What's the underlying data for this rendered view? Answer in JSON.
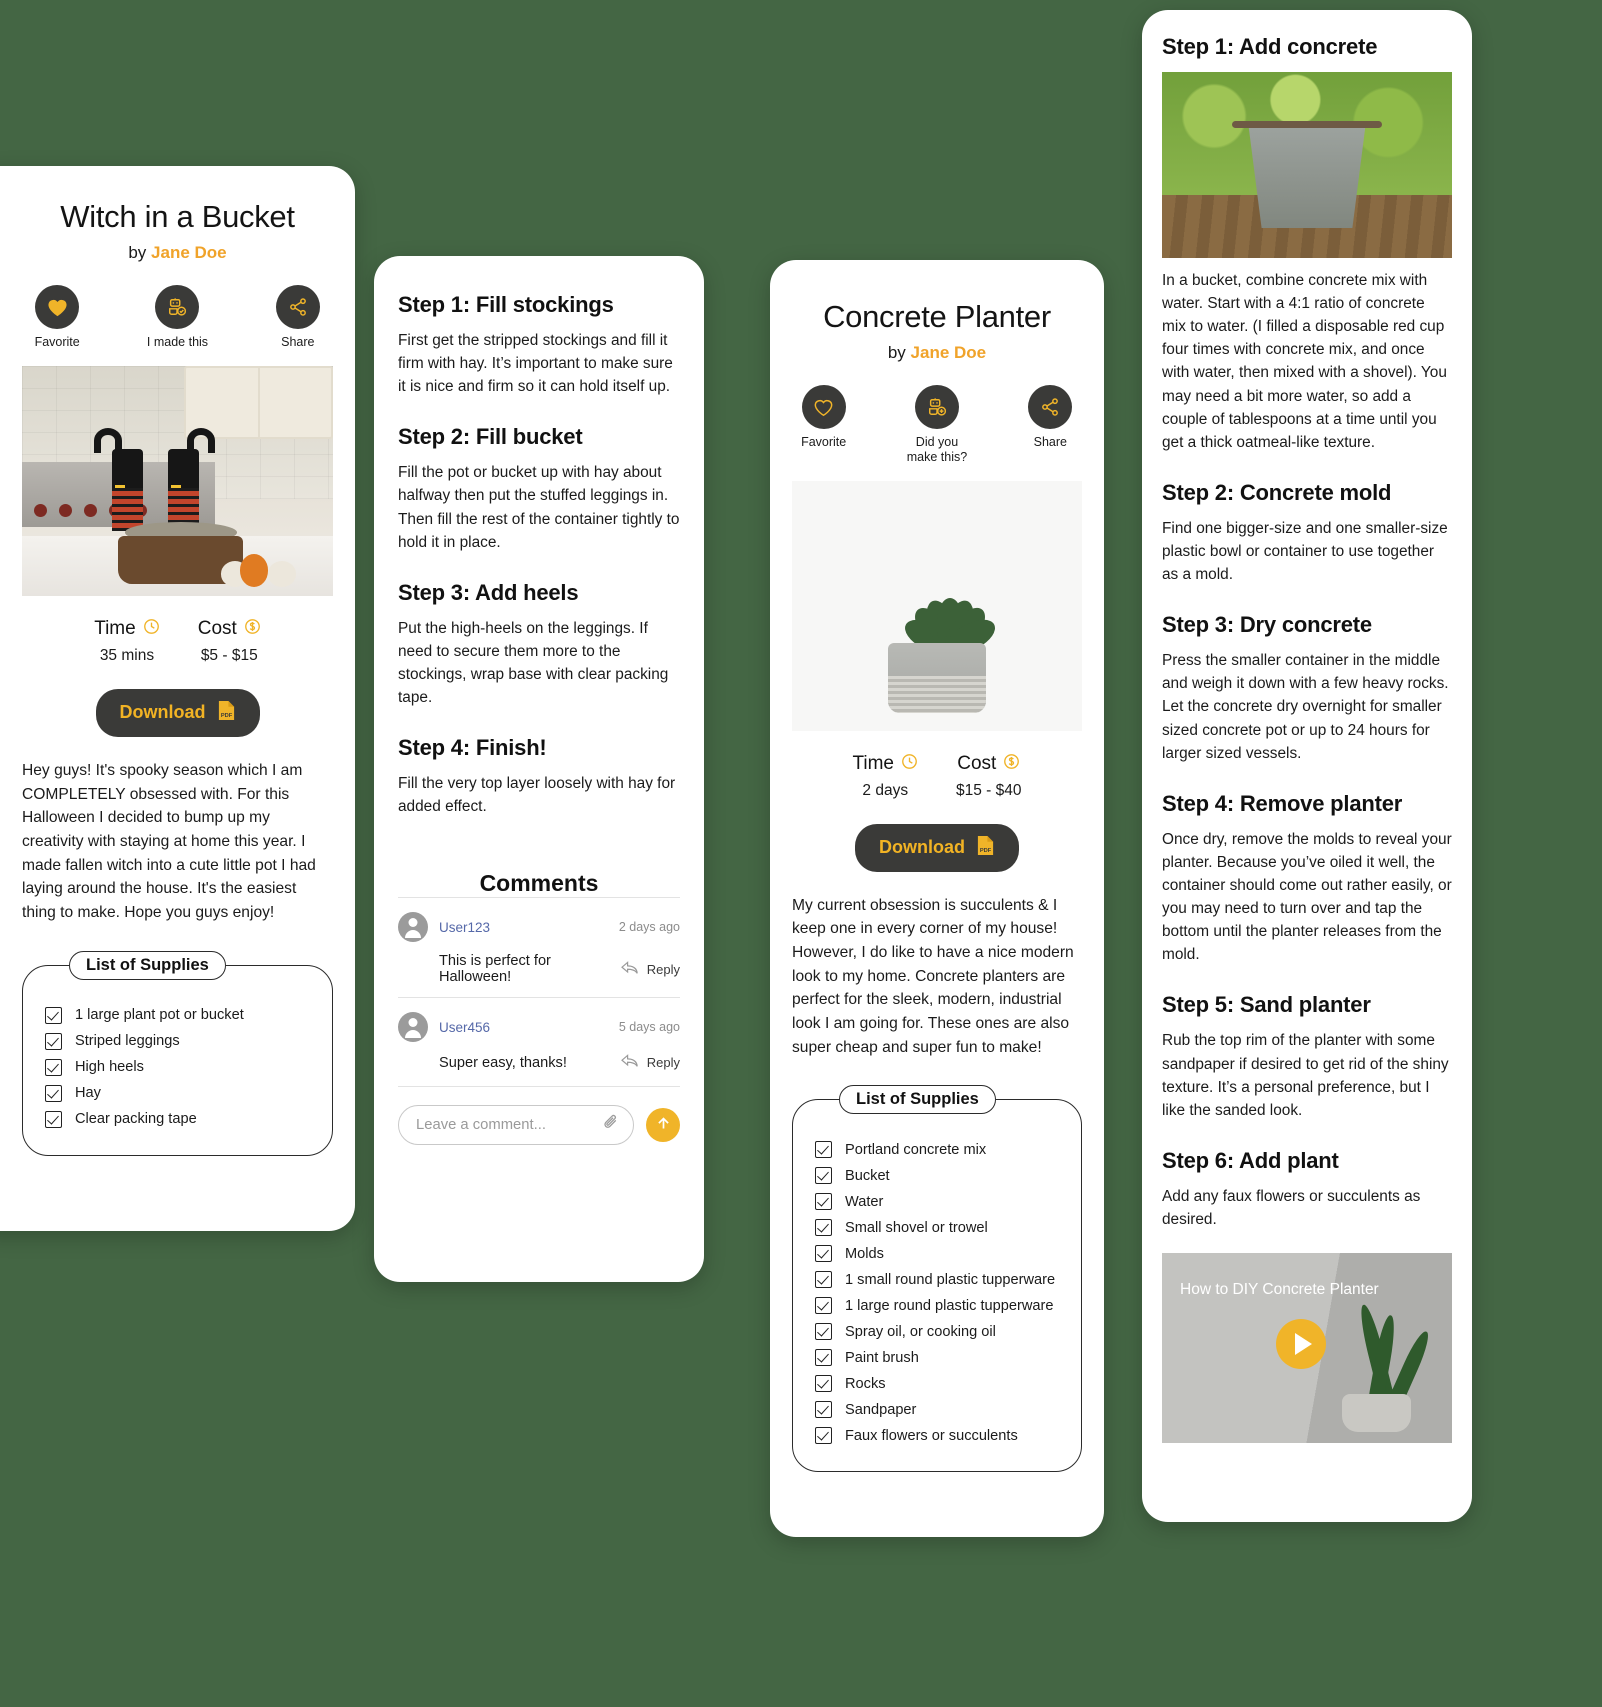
{
  "theme": {
    "background": "#446644",
    "accent": "#f0b429",
    "author_color": "#f0a32a",
    "dark": "#3a3a38"
  },
  "card_witch": {
    "title": "Witch in a Bucket",
    "by_label": "by",
    "author": "Jane Doe",
    "actions": [
      {
        "icon": "heart-filled-icon",
        "label": "Favorite"
      },
      {
        "icon": "made-this-icon",
        "label": "I made this"
      },
      {
        "icon": "share-icon",
        "label": "Share"
      }
    ],
    "hero_alt": "witch legs in a bucket on kitchen counter",
    "meta": [
      {
        "icon": "clock-icon",
        "label": "Time",
        "value": "35 mins"
      },
      {
        "icon": "dollar-icon",
        "label": "Cost",
        "value": "$5 - $15"
      }
    ],
    "download_label": "Download",
    "download_icon": "pdf-icon",
    "description": "Hey guys! It's spooky season which I am COMPLETELY obsessed with. For this Halloween I decided to bump up my creativity with staying at home this year. I made fallen witch into a cute little pot I had laying around the house. It's the easiest thing to make. Hope you guys enjoy!",
    "supplies_title": "List of Supplies",
    "supplies": [
      "1 large plant pot or bucket",
      "Striped leggings",
      "High heels",
      "Hay",
      "Clear packing tape"
    ]
  },
  "card_steps": {
    "steps": [
      {
        "heading": "Step 1: Fill stockings",
        "text": "First get the stripped stockings and fill it firm with hay. It’s important to make sure it is nice and firm so it can hold itself up."
      },
      {
        "heading": "Step 2: Fill bucket",
        "text": "Fill the pot or bucket up with hay about halfway then put the stuffed leggings in. Then fill the rest of the container tightly to hold it in place."
      },
      {
        "heading": "Step 3: Add heels",
        "text": "Put the high-heels on the leggings. If need to secure them more to the stockings, wrap base with clear packing tape."
      },
      {
        "heading": "Step 4: Finish!",
        "text": "Fill the very top layer loosely with hay for added effect."
      }
    ],
    "comments_title": "Comments",
    "comments": [
      {
        "user": "User123",
        "time": "2 days ago",
        "text": "This is perfect for Halloween!",
        "reply_label": "Reply"
      },
      {
        "user": "User456",
        "time": "5 days ago",
        "text": "Super easy, thanks!",
        "reply_label": "Reply"
      }
    ],
    "composer": {
      "placeholder": "Leave a comment...",
      "value": "",
      "attach_icon": "paperclip-icon",
      "send_icon": "arrow-up-icon"
    }
  },
  "card_planter": {
    "title": "Concrete Planter",
    "by_label": "by",
    "author": "Jane Doe",
    "actions": [
      {
        "icon": "heart-outline-icon",
        "label": "Favorite"
      },
      {
        "icon": "made-this-icon",
        "label": "Did you make this?"
      },
      {
        "icon": "share-icon",
        "label": "Share"
      }
    ],
    "hero_alt": "succulent in a concrete planter",
    "meta": [
      {
        "icon": "clock-icon",
        "label": "Time",
        "value": "2 days"
      },
      {
        "icon": "dollar-icon",
        "label": "Cost",
        "value": "$15 - $40"
      }
    ],
    "download_label": "Download",
    "download_icon": "pdf-icon",
    "description": "My current obsession is succulents & I keep one in every corner of my house! However, I do like to have a nice modern look to my home. Concrete planters are perfect for the sleek, modern, industrial look I am going for. These ones are also super cheap and super fun to make!",
    "supplies_title": "List of Supplies",
    "supplies": [
      "Portland concrete mix",
      "Bucket",
      "Water",
      "Small shovel or trowel",
      "Molds",
      "1 small round plastic tupperware",
      "1 large round plastic tupperware",
      "Spray oil, or cooking oil",
      "Paint brush",
      "Rocks",
      "Sandpaper",
      "Faux flowers or succulents"
    ]
  },
  "card_concrete": {
    "steps": [
      {
        "heading": "Step 1: Add concrete",
        "image_alt": "metal bucket on wooden plank outdoors",
        "text": "In a bucket, combine concrete mix with water. Start with a 4:1 ratio of concrete mix to water. (I filled a disposable red cup four times with concrete mix, and once with water, then mixed with a shovel). You may need a bit more water, so add a couple of tablespoons at a time until you get a thick oatmeal-like texture."
      },
      {
        "heading": "Step 2: Concrete mold",
        "text": "Find one bigger-size and one smaller-size plastic bowl or container to use together as a mold."
      },
      {
        "heading": "Step 3: Dry concrete",
        "text": "Press the smaller container in the middle and weigh it down with a few heavy rocks. Let the concrete dry overnight for smaller sized concrete pot or up to 24 hours for larger sized vessels."
      },
      {
        "heading": "Step 4: Remove planter",
        "text": "Once dry, remove the molds to reveal your planter. Because you’ve oiled it well, the container should come out rather easily, or you may need to turn over and tap the bottom until the planter releases from the mold."
      },
      {
        "heading": "Step 5: Sand planter",
        "text": "Rub the top rim of the planter with some sandpaper if desired to get rid of the shiny texture. It’s a personal preference, but I like the sanded look."
      },
      {
        "heading": "Step 6: Add plant",
        "text": "Add any faux flowers or succulents as desired."
      }
    ],
    "video": {
      "title": "How to DIY Concrete Planter",
      "play_icon": "play-icon"
    }
  }
}
